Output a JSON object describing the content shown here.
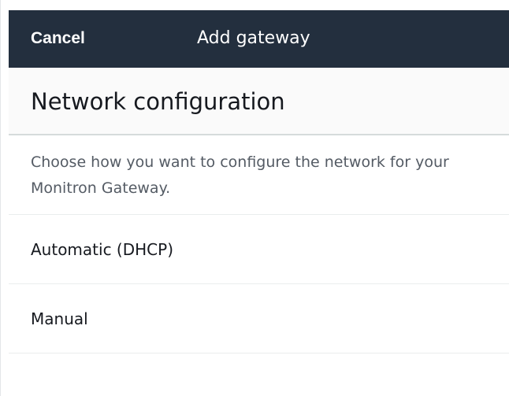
{
  "header": {
    "cancel_label": "Cancel",
    "title": "Add gateway",
    "background_color": "#232f3e"
  },
  "section": {
    "title": "Network configuration"
  },
  "description": "Choose how you want to configure the network for your Monitron Gateway.",
  "options": [
    {
      "label": "Automatic (DHCP)"
    },
    {
      "label": "Manual"
    }
  ]
}
